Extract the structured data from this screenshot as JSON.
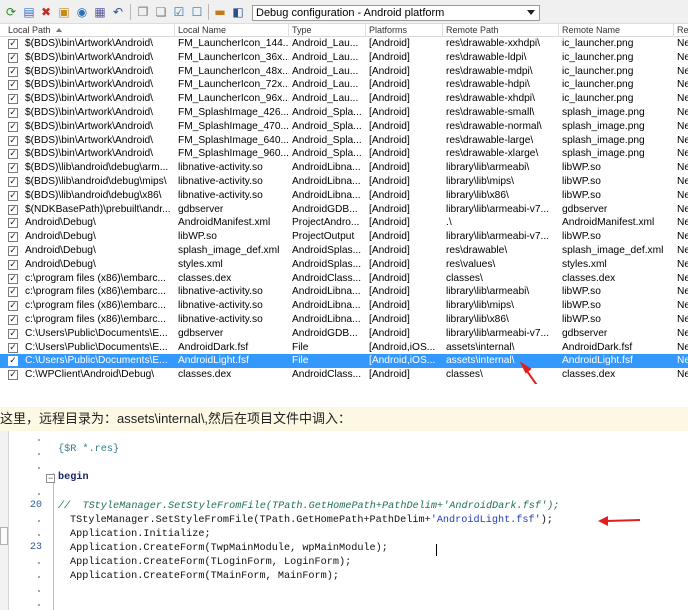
{
  "toolbar": {
    "icons": [
      "refresh-icon",
      "add-files-icon",
      "remove-files-icon",
      "add-featured-files-icon",
      "connect-icon",
      "deploy-icon",
      "revert-icon",
      "check-all-icon",
      "uncheck-all-icon",
      "show-changed-icon",
      "show-all-icon",
      "build-config-icon",
      "platform-icon"
    ],
    "config_value": "Debug configuration - Android platform"
  },
  "grid": {
    "columns": [
      "Local Path",
      "Local Name",
      "Type",
      "Platforms",
      "Remote Path",
      "Remote Name",
      "Re"
    ],
    "rows": [
      {
        "local_path": "$(BDS)\\bin\\Artwork\\Android\\",
        "local_name": "FM_LauncherIcon_144...",
        "type": "Android_Lau...",
        "platforms": "[Android]",
        "remote_path": "res\\drawable-xxhdpi\\",
        "remote_name": "ic_launcher.png",
        "re": "Ne"
      },
      {
        "local_path": "$(BDS)\\bin\\Artwork\\Android\\",
        "local_name": "FM_LauncherIcon_36x...",
        "type": "Android_Lau...",
        "platforms": "[Android]",
        "remote_path": "res\\drawable-ldpi\\",
        "remote_name": "ic_launcher.png",
        "re": "Ne"
      },
      {
        "local_path": "$(BDS)\\bin\\Artwork\\Android\\",
        "local_name": "FM_LauncherIcon_48x...",
        "type": "Android_Lau...",
        "platforms": "[Android]",
        "remote_path": "res\\drawable-mdpi\\",
        "remote_name": "ic_launcher.png",
        "re": "Ne"
      },
      {
        "local_path": "$(BDS)\\bin\\Artwork\\Android\\",
        "local_name": "FM_LauncherIcon_72x...",
        "type": "Android_Lau...",
        "platforms": "[Android]",
        "remote_path": "res\\drawable-hdpi\\",
        "remote_name": "ic_launcher.png",
        "re": "Ne"
      },
      {
        "local_path": "$(BDS)\\bin\\Artwork\\Android\\",
        "local_name": "FM_LauncherIcon_96x...",
        "type": "Android_Lau...",
        "platforms": "[Android]",
        "remote_path": "res\\drawable-xhdpi\\",
        "remote_name": "ic_launcher.png",
        "re": "Ne"
      },
      {
        "local_path": "$(BDS)\\bin\\Artwork\\Android\\",
        "local_name": "FM_SplashImage_426...",
        "type": "Android_Spla...",
        "platforms": "[Android]",
        "remote_path": "res\\drawable-small\\",
        "remote_name": "splash_image.png",
        "re": "Ne"
      },
      {
        "local_path": "$(BDS)\\bin\\Artwork\\Android\\",
        "local_name": "FM_SplashImage_470...",
        "type": "Android_Spla...",
        "platforms": "[Android]",
        "remote_path": "res\\drawable-normal\\",
        "remote_name": "splash_image.png",
        "re": "Ne"
      },
      {
        "local_path": "$(BDS)\\bin\\Artwork\\Android\\",
        "local_name": "FM_SplashImage_640...",
        "type": "Android_Spla...",
        "platforms": "[Android]",
        "remote_path": "res\\drawable-large\\",
        "remote_name": "splash_image.png",
        "re": "Ne"
      },
      {
        "local_path": "$(BDS)\\bin\\Artwork\\Android\\",
        "local_name": "FM_SplashImage_960...",
        "type": "Android_Spla...",
        "platforms": "[Android]",
        "remote_path": "res\\drawable-xlarge\\",
        "remote_name": "splash_image.png",
        "re": "Ne"
      },
      {
        "local_path": "$(BDS)\\lib\\android\\debug\\arm...",
        "local_name": "libnative-activity.so",
        "type": "AndroidLibna...",
        "platforms": "[Android]",
        "remote_path": "library\\lib\\armeabi\\",
        "remote_name": "libWP.so",
        "re": "Ne"
      },
      {
        "local_path": "$(BDS)\\lib\\android\\debug\\mips\\",
        "local_name": "libnative-activity.so",
        "type": "AndroidLibna...",
        "platforms": "[Android]",
        "remote_path": "library\\lib\\mips\\",
        "remote_name": "libWP.so",
        "re": "Ne"
      },
      {
        "local_path": "$(BDS)\\lib\\android\\debug\\x86\\",
        "local_name": "libnative-activity.so",
        "type": "AndroidLibna...",
        "platforms": "[Android]",
        "remote_path": "library\\lib\\x86\\",
        "remote_name": "libWP.so",
        "re": "Ne"
      },
      {
        "local_path": "$(NDKBasePath)\\prebuilt\\andr...",
        "local_name": "gdbserver",
        "type": "AndroidGDB...",
        "platforms": "[Android]",
        "remote_path": "library\\lib\\armeabi-v7...",
        "remote_name": "gdbserver",
        "re": "Ne"
      },
      {
        "local_path": "Android\\Debug\\",
        "local_name": "AndroidManifest.xml",
        "type": "ProjectAndro...",
        "platforms": "[Android]",
        "remote_path": ".\\",
        "remote_name": "AndroidManifest.xml",
        "re": "Ne"
      },
      {
        "local_path": "Android\\Debug\\",
        "local_name": "libWP.so",
        "type": "ProjectOutput",
        "platforms": "[Android]",
        "remote_path": "library\\lib\\armeabi-v7...",
        "remote_name": "libWP.so",
        "re": "Ne"
      },
      {
        "local_path": "Android\\Debug\\",
        "local_name": "splash_image_def.xml",
        "type": "AndroidSplas...",
        "platforms": "[Android]",
        "remote_path": "res\\drawable\\",
        "remote_name": "splash_image_def.xml",
        "re": "Ne"
      },
      {
        "local_path": "Android\\Debug\\",
        "local_name": "styles.xml",
        "type": "AndroidSplas...",
        "platforms": "[Android]",
        "remote_path": "res\\values\\",
        "remote_name": "styles.xml",
        "re": "Ne"
      },
      {
        "local_path": "c:\\program files (x86)\\embarc...",
        "local_name": "classes.dex",
        "type": "AndroidClass...",
        "platforms": "[Android]",
        "remote_path": "classes\\",
        "remote_name": "classes.dex",
        "re": "Ne"
      },
      {
        "local_path": "c:\\program files (x86)\\embarc...",
        "local_name": "libnative-activity.so",
        "type": "AndroidLibna...",
        "platforms": "[Android]",
        "remote_path": "library\\lib\\armeabi\\",
        "remote_name": "libWP.so",
        "re": "Ne"
      },
      {
        "local_path": "c:\\program files (x86)\\embarc...",
        "local_name": "libnative-activity.so",
        "type": "AndroidLibna...",
        "platforms": "[Android]",
        "remote_path": "library\\lib\\mips\\",
        "remote_name": "libWP.so",
        "re": "Ne"
      },
      {
        "local_path": "c:\\program files (x86)\\embarc...",
        "local_name": "libnative-activity.so",
        "type": "AndroidLibna...",
        "platforms": "[Android]",
        "remote_path": "library\\lib\\x86\\",
        "remote_name": "libWP.so",
        "re": "Ne"
      },
      {
        "local_path": "C:\\Users\\Public\\Documents\\E...",
        "local_name": "gdbserver",
        "type": "AndroidGDB...",
        "platforms": "[Android]",
        "remote_path": "library\\lib\\armeabi-v7...",
        "remote_name": "gdbserver",
        "re": "Ne"
      },
      {
        "local_path": "C:\\Users\\Public\\Documents\\E...",
        "local_name": "AndroidDark.fsf",
        "type": "File",
        "platforms": "[Android,iOS...",
        "remote_path": "assets\\internal\\",
        "remote_name": "AndroidDark.fsf",
        "re": "Ne"
      },
      {
        "local_path": "C:\\Users\\Public\\Documents\\E...",
        "local_name": "AndroidLight.fsf",
        "type": "File",
        "platforms": "[Android,iOS...",
        "remote_path": "assets\\internal\\",
        "remote_name": "AndroidLight.fsf",
        "re": "Ne",
        "selected": true
      },
      {
        "local_path": "C:\\WPClient\\Android\\Debug\\",
        "local_name": "classes.dex",
        "type": "AndroidClass...",
        "platforms": "[Android]",
        "remote_path": "classes\\",
        "remote_name": "classes.dex",
        "re": "Ne"
      }
    ]
  },
  "note": {
    "text": "这里，远程目录为：assets\\internal\\,然后在项目文件中调入："
  },
  "editor": {
    "line_numbers": {
      "l20": "20",
      "l23": "23"
    },
    "lines": {
      "res": "{$R *.res}",
      "begin": "begin",
      "comment": "//  TStyleManager.SetStyleFromFile(TPath.GetHomePath+PathDelim+'AndroidDark.fsf');",
      "style_pre": "TStyleManager.SetStyleFromFile(TPath.GetHomePath+PathDelim+",
      "style_str": "'AndroidLight.fsf'",
      "style_post": ");",
      "init": "Application.Initialize;",
      "create_main": "Application.CreateForm(TwpMainModule, wpMainModule);",
      "create_login": "Application.CreateForm(TLoginForm, LoginForm);",
      "create_form": "Application.CreateForm(TMainForm, MainForm);"
    }
  },
  "colors": {
    "selection": "#3399ff",
    "annotation": "#e02020",
    "note_background": "#fcf8e3"
  }
}
